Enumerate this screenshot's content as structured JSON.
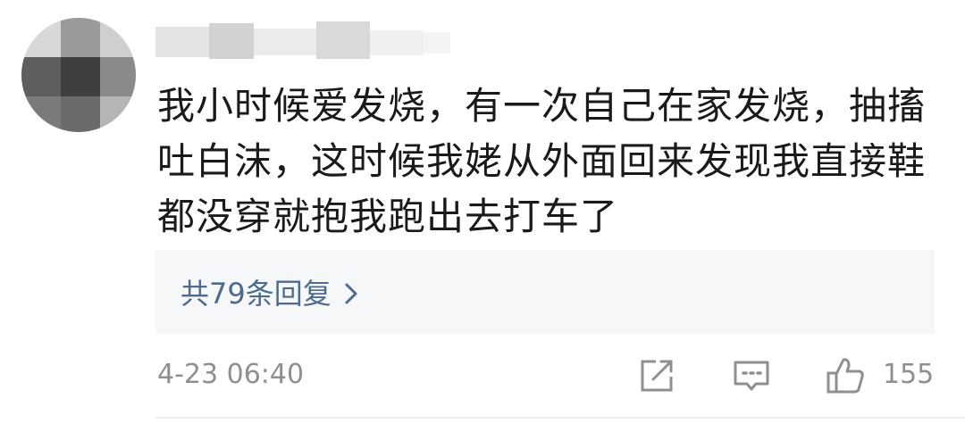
{
  "comment": {
    "text": "我小时候爱发烧，有一次自己在家发烧，抽搐吐白沫，这时候我姥从外面回来发现我直接鞋都没穿就抱我跑出去打车了",
    "replies_label": "共79条回复",
    "timestamp": "4-23 06:40",
    "like_count": "155"
  },
  "icons": {
    "share": "share-icon",
    "comment": "comment-icon",
    "like": "thumbs-up-icon",
    "replies_arrow": "chevron-right-icon"
  },
  "colors": {
    "text": "#1a1a1a",
    "link": "#4d6b8a",
    "meta": "#8f8f8f",
    "reply_bg": "#f6f7f9"
  }
}
